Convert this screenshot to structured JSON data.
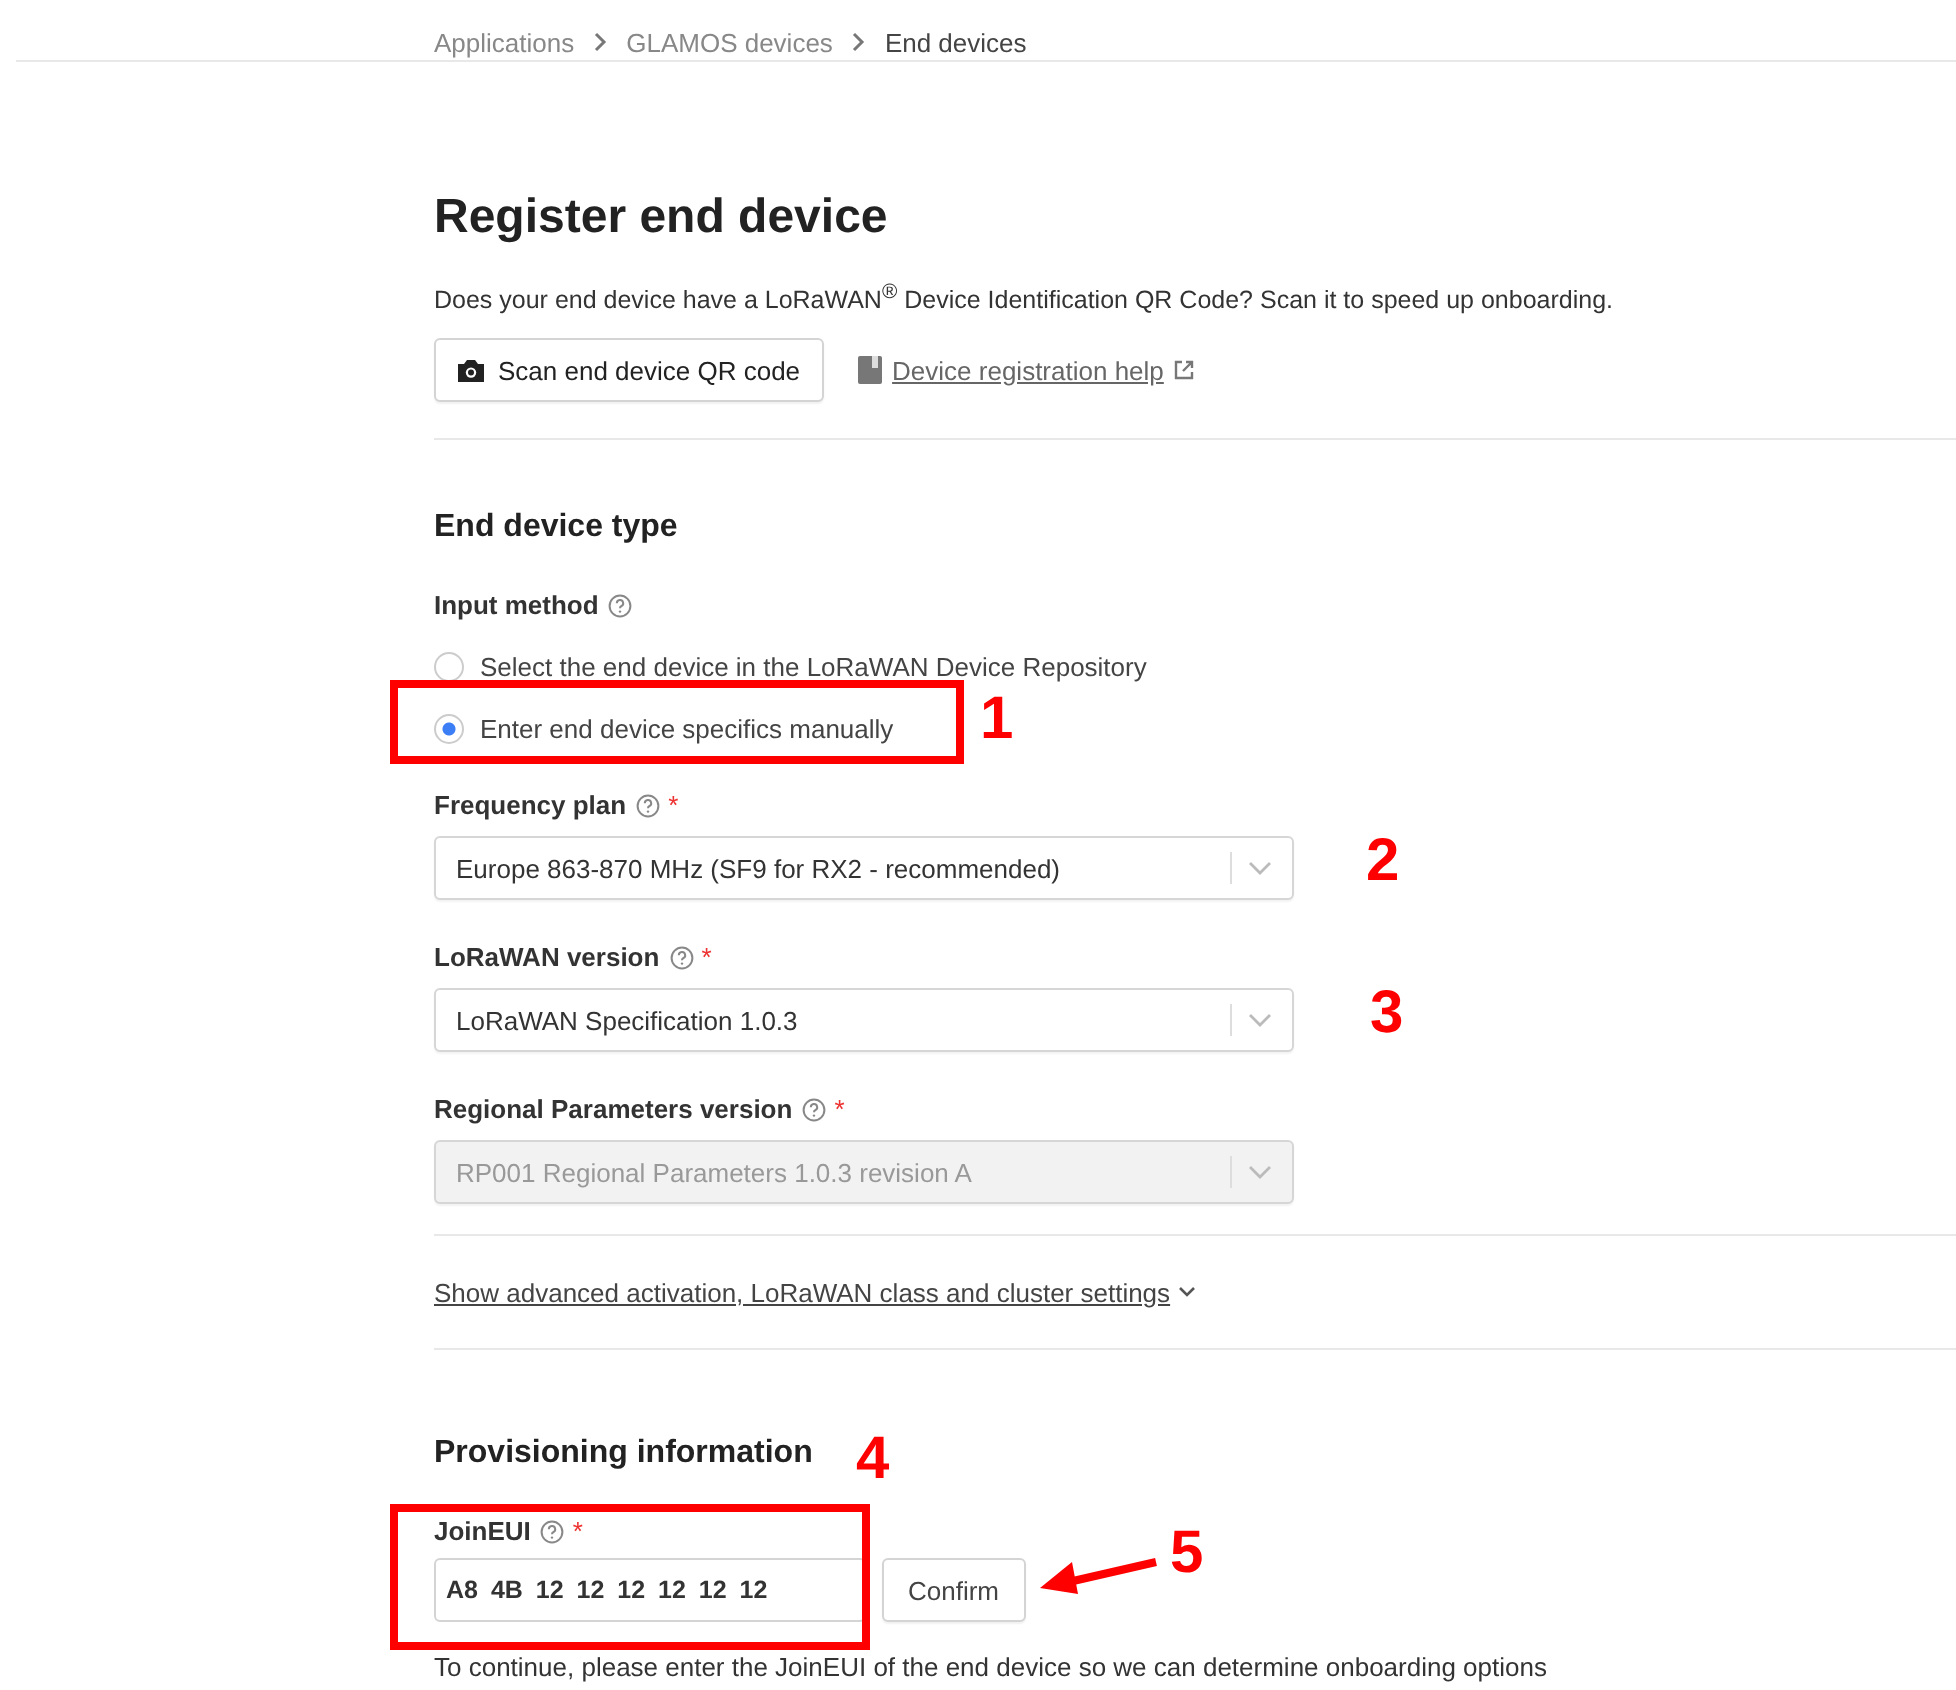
{
  "breadcrumb": [
    {
      "label": "Applications",
      "current": false
    },
    {
      "label": "GLAMOS devices",
      "current": false
    },
    {
      "label": "End devices",
      "current": true
    }
  ],
  "title": "Register end device",
  "intro": "Does your end device have a LoRaWAN$^{®}$ Device Identification QR Code? Scan it to speed up onboarding.",
  "scan_button": "Scan end device QR code",
  "help_link": "Device registration help",
  "end_device_type": {
    "heading": "End device type",
    "input_method": {
      "label": "Input method",
      "options": [
        {
          "label": "Select the end device in the LoRaWAN Device Repository",
          "selected": false
        },
        {
          "label": "Enter end device specifics manually",
          "selected": true
        }
      ]
    },
    "fields": [
      {
        "label": "Frequency plan",
        "required_mark": "*",
        "value": "Europe 863-870 MHz (SF9 for RX2 - recommended)",
        "disabled": false
      },
      {
        "label": "LoRaWAN version",
        "required_mark": "*",
        "value": "LoRaWAN Specification 1.0.3",
        "disabled": false
      },
      {
        "label": "Regional Parameters version",
        "required_mark": "*",
        "value": "RP001 Regional Parameters 1.0.3 revision A",
        "disabled": true
      }
    ]
  },
  "advanced_link": "Show advanced activation, LoRaWAN class and cluster settings",
  "provisioning": {
    "heading": "Provisioning information",
    "join_eui": {
      "label": "JoinEUI",
      "required_mark": "*",
      "value": "A8 4B 12 12 12 12 12 12"
    },
    "confirm_button": "Confirm",
    "hint": "To continue, please enter the JoinEUI of the end device so we can determine onboarding options"
  },
  "annotations": [
    {
      "number": "1",
      "kind": "boxed"
    },
    {
      "number": "2",
      "kind": "plain"
    },
    {
      "number": "3",
      "kind": "plain"
    },
    {
      "number": "4",
      "kind": "boxed"
    },
    {
      "number": "5",
      "kind": "arrow"
    }
  ]
}
